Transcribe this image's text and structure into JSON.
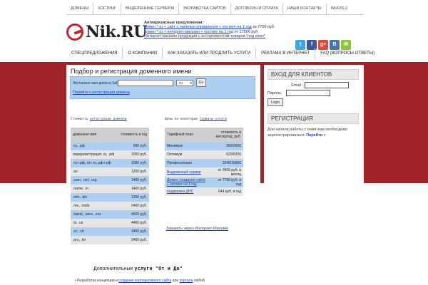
{
  "top_nav": [
    "ДОМЕНЫ",
    "ХОСТИНГ",
    "ВЫДЕЛЕННЫЕ СЕРВЕРЫ",
    "РАЗРАБОТКА САЙТОВ",
    "ДОГОВОРЫ И ОПЛАТА",
    "НАШИ КОНТАКТЫ",
    "WHOIS-2"
  ],
  "logo": {
    "text": "Nik.RU"
  },
  "promo": {
    "heading": "Антикризисные предложения:",
    "lines": [
      {
        "link": "домен *.ru + сайт с панелью управления + хостинг на 1 год",
        "suffix": " за 7700 руб."
      },
      {
        "link": "домен *.ru + интернет-магазин + хостинг на 1 год",
        "suffix": " от 17500 руб."
      },
      {
        "link": "Интернет-магазин продукции с ассортиментом товаров \"под ключ\"",
        "suffix": ""
      }
    ]
  },
  "social": [
    {
      "icon": "twitter-icon",
      "glyph": "t",
      "color": "#3fa9dd"
    },
    {
      "icon": "facebook-icon",
      "glyph": "f",
      "color": "#3b5998"
    },
    {
      "icon": "google-plus-icon",
      "glyph": "g+",
      "color": "#dd4b39"
    },
    {
      "icon": "vk-icon",
      "glyph": "B",
      "color": "#4c75a3"
    },
    {
      "icon": "mail-icon",
      "glyph": "✉",
      "color": "#8cc63f"
    }
  ],
  "main_nav": [
    "СПЕЦПРЕДЛОЖЕНИЯ",
    "О КОМПАНИИ",
    "КАК ЗАКАЗАТЬ ИЛИ ПРОДЛИТЬ УСЛУГИ",
    "РЕКЛАМА В ИНТЕРНЕТ",
    "FAQ (ВОПРОСЫ-ОТВЕТЫ)"
  ],
  "content": {
    "title": "Подбор и регистрация доменного имени",
    "search": {
      "label": "Желаемое имя домена (lat):",
      "value": "",
      "zone": ".ru",
      "go": "Go",
      "link": "Перейти к регистрации домена"
    }
  },
  "domain_table": {
    "caption_prefix": "Стоимость ",
    "caption_link": "регистрации доменов",
    "headers": [
      "доменное имя",
      "стоимость в год"
    ],
    "rows": [
      [
        ".ru, .рф",
        "600 руб."
      ],
      [
        "перерегистрация .ru, .рф",
        "1000 руб."
      ],
      [
        ".ru+.рф,.ru+.ru,.рф+.рф",
        "1000 руб."
      ],
      [
        ".su",
        "1200 руб."
      ],
      [
        ".com, .net, .org",
        "1400 руб."
      ],
      [
        ".name, .in",
        "1400 руб."
      ],
      [
        ".info, .biz",
        "1200 руб."
      ],
      [
        ".me, .mobi",
        "2400 руб."
      ],
      [
        ".travel, .aero, .xxx",
        "4500 руб."
      ],
      [
        ".tv, .us",
        "4400 руб."
      ],
      [
        ".cc, .ch",
        "2400 руб."
      ],
      [
        ".pro, .tel",
        "2400 руб."
      ]
    ]
  },
  "service_table": {
    "caption_prefix": "Цены на некоторые ",
    "caption_link": "Сервисы услуги",
    "headers": [
      "Тарифный план",
      "стоимость в месяц/год, руб."
    ],
    "rows": [
      {
        "cells": [
          "Минимум",
          "260/2600"
        ],
        "link": false
      },
      {
        "cells": [
          "Оптимум",
          "620/6200"
        ],
        "link": false
      },
      {
        "cells": [
          "Профессионал",
          "1540/15600"
        ],
        "link": false
      },
      {
        "cells": [
          "Выделенный сервер",
          "от 9400 руб. в месяц"
        ],
        "link": true
      },
      {
        "cells": [
          "Домен, создание сайта + хостинг на 1 год",
          "от 7700 руб. в год"
        ],
        "link": true
      },
      {
        "cells": [
          "поддержка ДНС",
          "644 руб. в год"
        ],
        "link": true
      }
    ],
    "order_link": "Заказать через Интернет-Магазин"
  },
  "extra": {
    "prefix": "Дополнительные ",
    "highlight": "услуги \"От и До\"",
    "bullet_prefix": "Разработка концепции и ",
    "bullet_link1": "создание корпоративного сайта",
    "bullet_mid": " или ",
    "bullet_link2": "портала",
    "bullet_suffix": " любой"
  },
  "sidebar": {
    "login_title": "ВХОД ДЛЯ КЛИЕНТОВ",
    "email_label": "Email :",
    "password_label": "Пароль:",
    "login_button": "Login",
    "reg_title": "РЕГИСТРАЦИЯ",
    "reg_text": "Для начала работы с нами вам необходимо зарегистрироваться.",
    "reg_link": "Перейти »"
  }
}
